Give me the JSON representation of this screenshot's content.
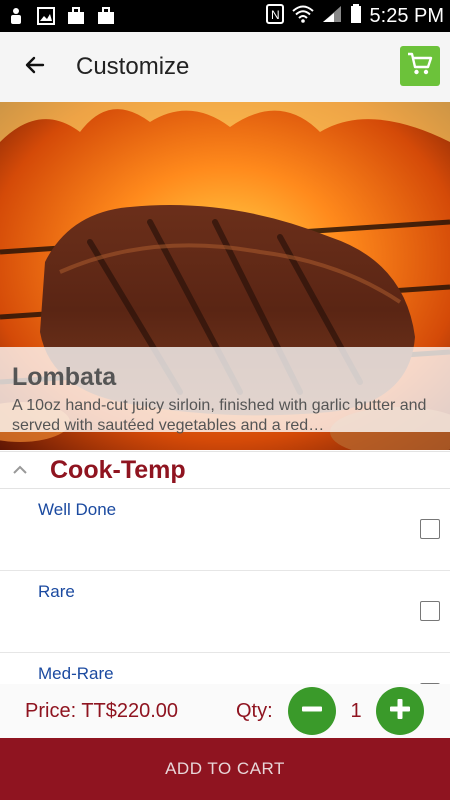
{
  "status_bar": {
    "time": "5:25 PM",
    "icons": [
      "notification-icon",
      "gallery-icon",
      "briefcase-icon",
      "briefcase-icon",
      "nfc-icon",
      "wifi-icon",
      "signal-icon",
      "battery-icon"
    ]
  },
  "app_bar": {
    "title": "Customize",
    "back_icon": "arrow-left-icon",
    "cart_icon": "shopping-cart-icon",
    "cart_color": "#6cc23a"
  },
  "item": {
    "name": "Lombata",
    "description": "A 10oz hand-cut juicy sirloin, finished with garlic butter and served with sautéed vegetables and a red…"
  },
  "section": {
    "title": "Cook-Temp",
    "title_color": "#8f1420",
    "collapse_icon": "chevron-up-icon",
    "options": [
      {
        "label": "Well Done",
        "checked": false
      },
      {
        "label": "Rare",
        "checked": false
      },
      {
        "label": "Med-Rare",
        "checked": false
      }
    ]
  },
  "order": {
    "price": "Price: TT$220.00",
    "qty_label": "Qty:",
    "qty_value": "1",
    "button_color": "#3a9a2a"
  },
  "cta": {
    "label": "ADD TO CART",
    "color": "#8f1420"
  }
}
